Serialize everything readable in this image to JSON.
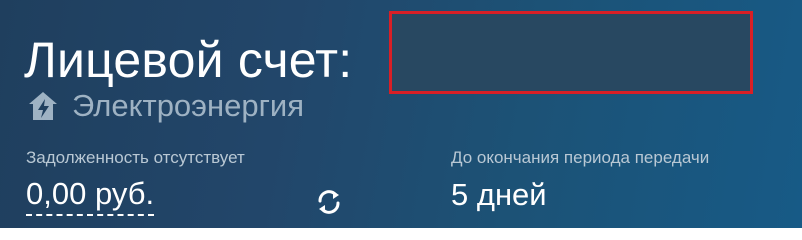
{
  "account": {
    "title": "Лицевой счет:",
    "number": ""
  },
  "service": {
    "icon": "house-lightning-icon",
    "label": "Электроэнергия"
  },
  "debt": {
    "caption": "Задолженность отсутствует",
    "amount": "0,00 руб."
  },
  "refresh": {
    "icon": "refresh-icon"
  },
  "period": {
    "caption": "До окончания периода передачи",
    "value": "5 дней"
  },
  "colors": {
    "background_start": "#1f3f5e",
    "background_end": "#175a86",
    "highlight_border": "#d81f26",
    "primary_text": "#ffffff",
    "muted_text": "#9eb2c3"
  }
}
